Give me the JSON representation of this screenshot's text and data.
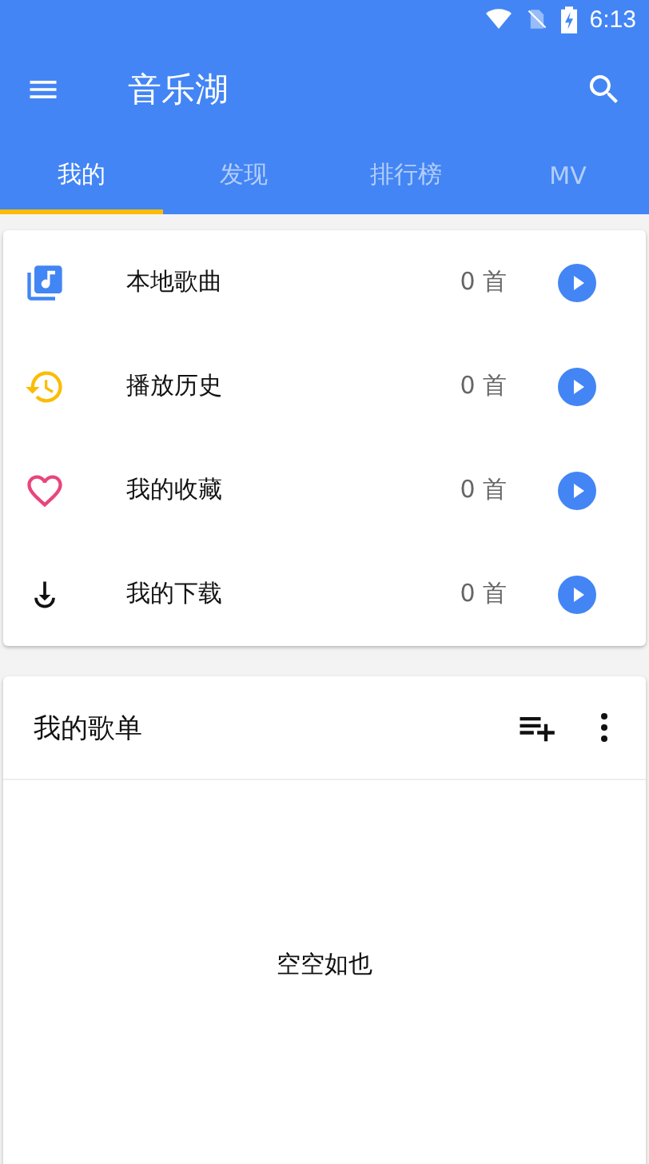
{
  "status_bar": {
    "time": "6:13"
  },
  "toolbar": {
    "title": "音乐湖"
  },
  "tabs": [
    {
      "label": "我的",
      "selected": true
    },
    {
      "label": "发现",
      "selected": false
    },
    {
      "label": "排行榜",
      "selected": false
    },
    {
      "label": "MV",
      "selected": false
    }
  ],
  "library": [
    {
      "kind": "local",
      "label": "本地歌曲",
      "count": "0 首"
    },
    {
      "kind": "history",
      "label": "播放历史",
      "count": "0 首"
    },
    {
      "kind": "favorite",
      "label": "我的收藏",
      "count": "0 首"
    },
    {
      "kind": "download",
      "label": "我的下载",
      "count": "0 首"
    }
  ],
  "playlists": {
    "title": "我的歌单",
    "empty_text": "空空如也"
  }
}
